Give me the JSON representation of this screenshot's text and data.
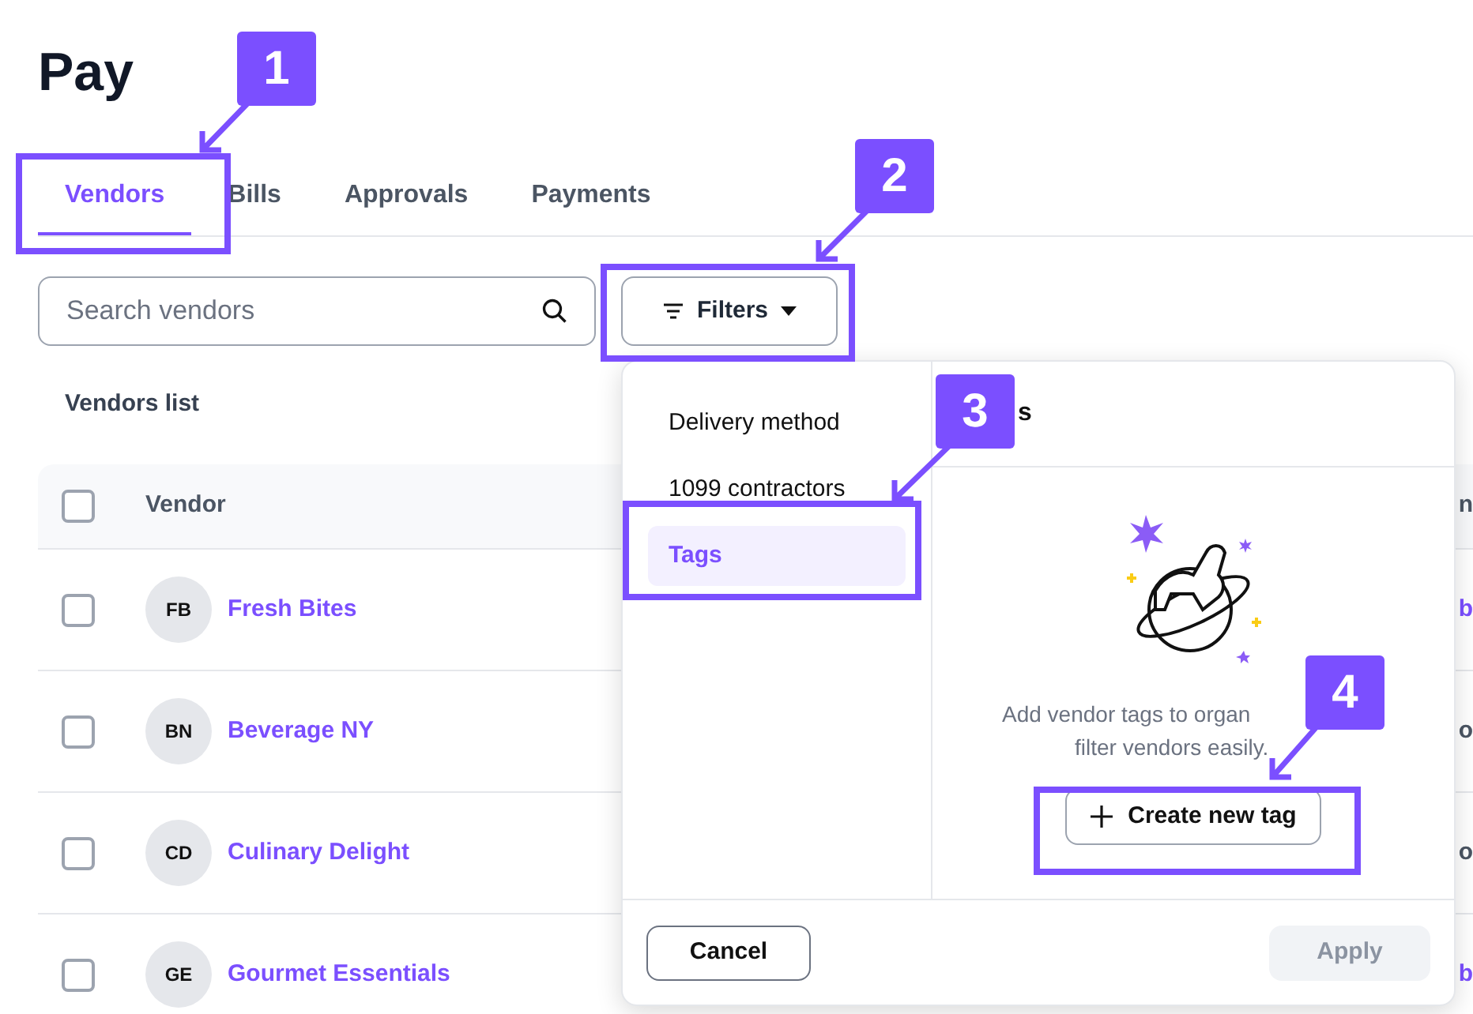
{
  "page": {
    "title": "Pay"
  },
  "tabs": [
    {
      "label": "Vendors",
      "selected": true
    },
    {
      "label": "Bills",
      "selected": false
    },
    {
      "label": "Approvals",
      "selected": false
    },
    {
      "label": "Payments",
      "selected": false
    }
  ],
  "search": {
    "placeholder": "Search vendors"
  },
  "filters_button": {
    "label": "Filters",
    "expanded": true
  },
  "section_title": "Vendors list",
  "table": {
    "select_all": {
      "checked": false
    },
    "columns": [
      "Vendor",
      "n"
    ],
    "rows": [
      {
        "checked": false,
        "initials": "FB",
        "vendor": "Fresh Bites",
        "column_2": "b"
      },
      {
        "checked": false,
        "initials": "BN",
        "vendor": "Beverage NY",
        "column_2": "o"
      },
      {
        "checked": false,
        "initials": "CD",
        "vendor": "Culinary Delight",
        "column_2": "o"
      },
      {
        "checked": false,
        "initials": "GE",
        "vendor": "Gourmet Essentials",
        "column_2": "b"
      }
    ]
  },
  "filter_menu": {
    "categories": [
      {
        "label": "Delivery method",
        "selected": false
      },
      {
        "label": "1099 contractors",
        "selected": false
      },
      {
        "label": "Tags",
        "selected": true
      }
    ],
    "panel_title": "s",
    "empty_text": [
      "Add vendor tags to organ",
      "filter vendors easily."
    ],
    "create_button": "Create new tag",
    "cancel_button": "Cancel",
    "apply_button": {
      "label": "Apply",
      "disabled": true
    }
  },
  "callouts": [
    "1",
    "2",
    "3",
    "4"
  ]
}
